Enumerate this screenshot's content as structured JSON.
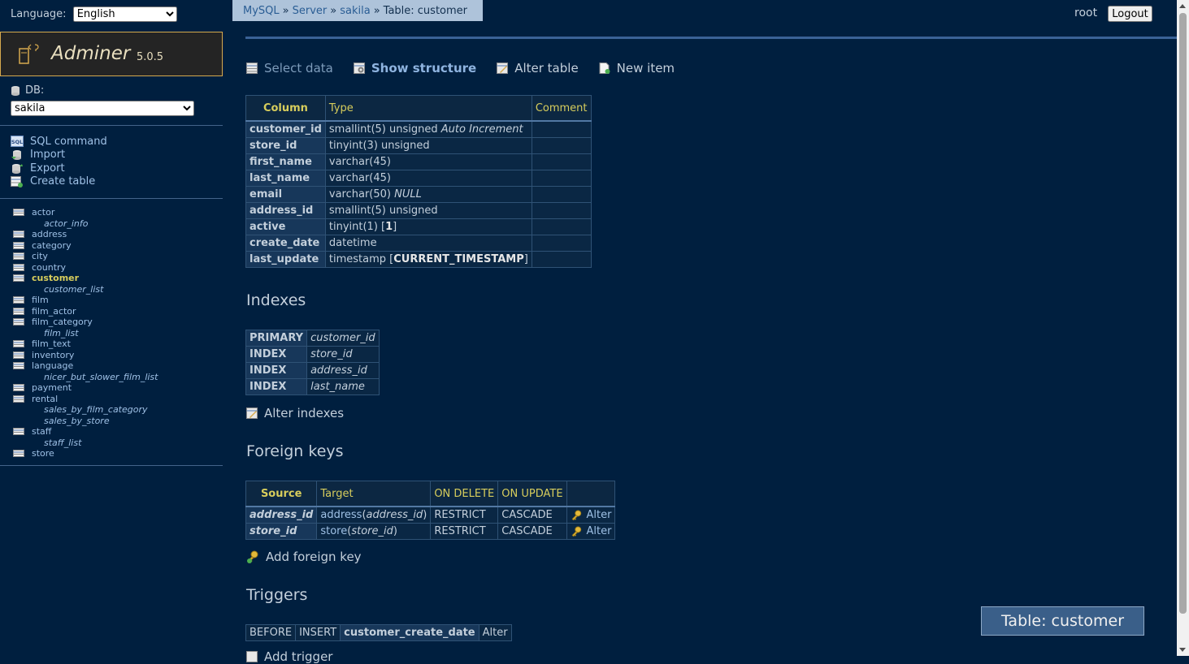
{
  "language": {
    "label": "Language:",
    "selected": "English"
  },
  "brand": {
    "name": "Adminer",
    "version": "5.0.5"
  },
  "db": {
    "label": "DB:",
    "selected": "sakila"
  },
  "commands": [
    {
      "label": "SQL command",
      "icon": "sql-icon"
    },
    {
      "label": "Import",
      "icon": "import-icon"
    },
    {
      "label": "Export",
      "icon": "export-icon"
    },
    {
      "label": "Create table",
      "icon": "create-table-icon"
    }
  ],
  "tables": [
    {
      "name": "actor",
      "view": false
    },
    {
      "name": "actor_info",
      "view": true
    },
    {
      "name": "address",
      "view": false
    },
    {
      "name": "category",
      "view": false
    },
    {
      "name": "city",
      "view": false
    },
    {
      "name": "country",
      "view": false
    },
    {
      "name": "customer",
      "view": false,
      "current": true
    },
    {
      "name": "customer_list",
      "view": true
    },
    {
      "name": "film",
      "view": false
    },
    {
      "name": "film_actor",
      "view": false
    },
    {
      "name": "film_category",
      "view": false
    },
    {
      "name": "film_list",
      "view": true
    },
    {
      "name": "film_text",
      "view": false
    },
    {
      "name": "inventory",
      "view": false
    },
    {
      "name": "language",
      "view": false
    },
    {
      "name": "nicer_but_slower_film_list",
      "view": true
    },
    {
      "name": "payment",
      "view": false
    },
    {
      "name": "rental",
      "view": false
    },
    {
      "name": "sales_by_film_category",
      "view": true
    },
    {
      "name": "sales_by_store",
      "view": true
    },
    {
      "name": "staff",
      "view": false
    },
    {
      "name": "staff_list",
      "view": true
    },
    {
      "name": "store",
      "view": false
    }
  ],
  "breadcrumb": {
    "mysql": "MySQL",
    "server": "Server",
    "db": "sakila",
    "sep": "»",
    "current": "Table: customer"
  },
  "user": {
    "name": "root",
    "logout": "Logout"
  },
  "actions": {
    "select_data": "Select data",
    "show_structure": "Show structure",
    "alter_table": "Alter table",
    "new_item": "New item"
  },
  "structure": {
    "headers": {
      "column": "Column",
      "type": "Type",
      "comment": "Comment"
    },
    "rows": [
      {
        "column": "customer_id",
        "type": "smallint(5) unsigned",
        "extra": "Auto Increment",
        "comment": ""
      },
      {
        "column": "store_id",
        "type": "tinyint(3) unsigned",
        "comment": ""
      },
      {
        "column": "first_name",
        "type": "varchar(45)",
        "comment": ""
      },
      {
        "column": "last_name",
        "type": "varchar(45)",
        "comment": ""
      },
      {
        "column": "email",
        "type": "varchar(50)",
        "extra": "NULL",
        "comment": ""
      },
      {
        "column": "address_id",
        "type": "smallint(5) unsigned",
        "comment": ""
      },
      {
        "column": "active",
        "type": "tinyint(1)",
        "default": "1",
        "comment": ""
      },
      {
        "column": "create_date",
        "type": "datetime",
        "comment": ""
      },
      {
        "column": "last_update",
        "type": "timestamp",
        "default": "CURRENT_TIMESTAMP",
        "comment": ""
      }
    ]
  },
  "indexes": {
    "title": "Indexes",
    "rows": [
      {
        "type": "PRIMARY",
        "columns": "customer_id"
      },
      {
        "type": "INDEX",
        "columns": "store_id"
      },
      {
        "type": "INDEX",
        "columns": "address_id"
      },
      {
        "type": "INDEX",
        "columns": "last_name"
      }
    ],
    "alter_label": "Alter indexes"
  },
  "foreign_keys": {
    "title": "Foreign keys",
    "headers": {
      "source": "Source",
      "target": "Target",
      "on_delete": "ON DELETE",
      "on_update": "ON UPDATE"
    },
    "rows": [
      {
        "source": "address_id",
        "target_table": "address",
        "target_column": "address_id",
        "on_delete": "RESTRICT",
        "on_update": "CASCADE",
        "alter": "Alter"
      },
      {
        "source": "store_id",
        "target_table": "store",
        "target_column": "store_id",
        "on_delete": "RESTRICT",
        "on_update": "CASCADE",
        "alter": "Alter"
      }
    ],
    "add_label": "Add foreign key"
  },
  "triggers": {
    "title": "Triggers",
    "rows": [
      {
        "timing": "BEFORE",
        "event": "INSERT",
        "name": "customer_create_date",
        "alter": "Alter"
      }
    ],
    "add_label": "Add trigger"
  },
  "float_title": "Table: customer"
}
